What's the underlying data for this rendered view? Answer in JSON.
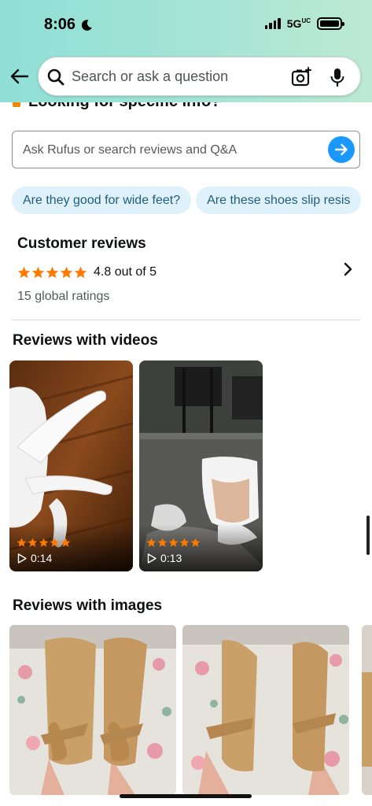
{
  "status_bar": {
    "time": "8:06",
    "network": "5G",
    "network_suffix": "UC"
  },
  "search": {
    "placeholder": "Search or ask a question"
  },
  "clipped_heading": "Looking for specific info?",
  "rufus": {
    "placeholder": "Ask Rufus or search reviews and Q&A"
  },
  "chips": [
    "Are they good for wide feet?",
    "Are these shoes slip resis"
  ],
  "customer_reviews": {
    "title": "Customer reviews",
    "rating_text": "4.8 out of 5",
    "rating_value": 4.8,
    "global_ratings": "15 global ratings"
  },
  "videos": {
    "title": "Reviews with videos",
    "items": [
      {
        "stars": 5,
        "duration": "0:14"
      },
      {
        "stars": 5,
        "duration": "0:13"
      }
    ]
  },
  "images": {
    "title": "Reviews with images"
  },
  "colors": {
    "star": "#ff7a00",
    "accent_blue": "#1a98ff",
    "chip_bg": "#dff1fa",
    "header_start": "#8fdfd7",
    "header_end": "#bde9d2"
  },
  "icons": [
    "moon-icon",
    "signal-icon",
    "battery-icon",
    "back-arrow-icon",
    "search-icon",
    "camera-icon",
    "microphone-icon",
    "arrow-right-icon",
    "star-icon",
    "chevron-right-icon",
    "play-icon"
  ]
}
